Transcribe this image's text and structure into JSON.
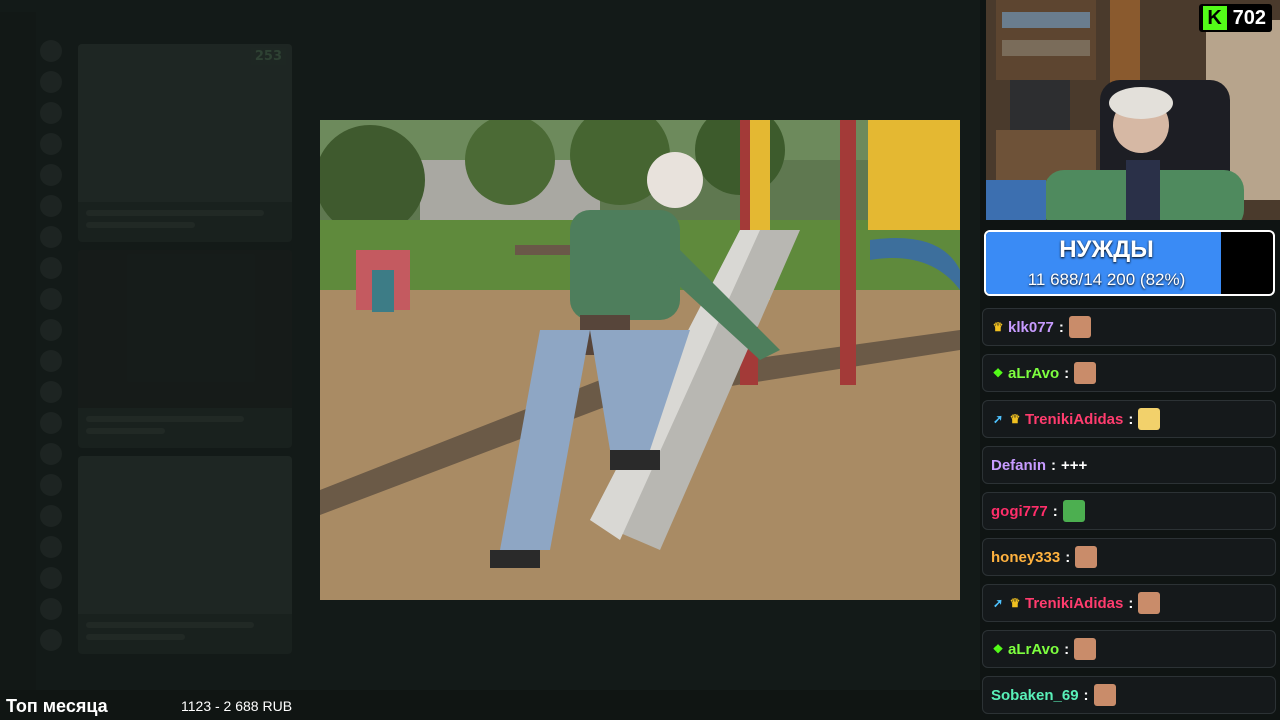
{
  "stream": {
    "viewer_count": "702",
    "platform_logo": "K",
    "bottom": {
      "top_month_label": "Топ месяца",
      "donation_range": "1123 - 2 688 RUB"
    }
  },
  "goal": {
    "title": "НУЖДЫ",
    "progress_text": "11 688/14 200 (82%)",
    "progress_fraction": 0.82,
    "fill_color": "#3a8bf5"
  },
  "background_feed": {
    "badge_value": "253"
  },
  "chat": {
    "messages": [
      {
        "user": "klk077",
        "color": "#c79bff",
        "badges": [
          "crown-icon"
        ],
        "text": "",
        "emote": "face-emote"
      },
      {
        "user": "aLrAvo",
        "color": "#7dff3f",
        "badges": [
          "gift-icon"
        ],
        "text": "",
        "emote": "face-emote"
      },
      {
        "user": "TrenikiAdidas",
        "color": "#ff3c6e",
        "badges": [
          "boost-icon",
          "crown-icon"
        ],
        "text": "",
        "emote": "cheese-emote"
      },
      {
        "user": "Defanin",
        "color": "#c79bff",
        "badges": [],
        "text": "+++",
        "emote": ""
      },
      {
        "user": "gogi777",
        "color": "#ff2e6a",
        "badges": [],
        "text": "",
        "emote": "pepe-emote"
      },
      {
        "user": "honey333",
        "color": "#ffb23f",
        "badges": [],
        "text": "",
        "emote": "face-emote"
      },
      {
        "user": "TrenikiAdidas",
        "color": "#ff3c6e",
        "badges": [
          "boost-icon",
          "crown-icon"
        ],
        "text": "",
        "emote": "face-emote"
      },
      {
        "user": "aLrAvo",
        "color": "#7dff3f",
        "badges": [
          "gift-icon"
        ],
        "text": "",
        "emote": "face-emote"
      },
      {
        "user": "Sobaken_69",
        "color": "#59f0b8",
        "badges": [],
        "text": "",
        "emote": "face-emote"
      }
    ]
  }
}
